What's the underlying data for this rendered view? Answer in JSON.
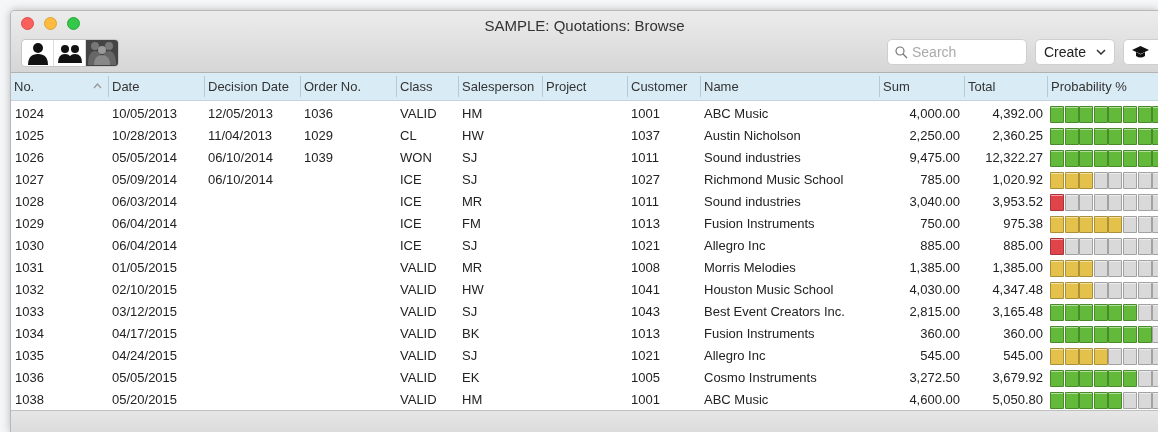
{
  "window": {
    "title": "SAMPLE: Quotations: Browse"
  },
  "toolbar": {
    "search": {
      "placeholder": "Search"
    },
    "create_button": "Create"
  },
  "table": {
    "columns": [
      {
        "label": "No.",
        "sorted": true,
        "kind": "text"
      },
      {
        "label": "Date",
        "sorted": false,
        "kind": "text"
      },
      {
        "label": "Decision Date",
        "sorted": false,
        "kind": "text"
      },
      {
        "label": "Order No.",
        "sorted": false,
        "kind": "text"
      },
      {
        "label": "Class",
        "sorted": false,
        "kind": "text"
      },
      {
        "label": "Salesperson",
        "sorted": false,
        "kind": "text"
      },
      {
        "label": "Project",
        "sorted": false,
        "kind": "text"
      },
      {
        "label": "Customer",
        "sorted": false,
        "kind": "text"
      },
      {
        "label": "Name",
        "sorted": false,
        "kind": "text"
      },
      {
        "label": "Sum",
        "sorted": false,
        "kind": "number"
      },
      {
        "label": "Total",
        "sorted": false,
        "kind": "number"
      },
      {
        "label": "Probability %",
        "sorted": false,
        "kind": "meter"
      }
    ],
    "rows": [
      {
        "cells": [
          "1024",
          "10/05/2013",
          "12/05/2013",
          "1036",
          "VALID",
          "HM",
          "",
          "1001",
          "ABC Music",
          "4,000.00",
          "4,392.00"
        ],
        "segments": [
          {
            "color": "#62b93a"
          },
          {
            "color": "#62b93a"
          },
          {
            "color": "#62b93a"
          },
          {
            "color": "#62b93a"
          },
          {
            "color": "#62b93a"
          },
          {
            "color": "#62b93a"
          },
          {
            "color": "#62b93a"
          },
          {
            "color": "#62b93a"
          }
        ]
      },
      {
        "cells": [
          "1025",
          "10/28/2013",
          "11/04/2013",
          "1029",
          "CL",
          "HW",
          "",
          "1037",
          "Austin Nicholson",
          "2,250.00",
          "2,360.25"
        ],
        "segments": [
          {
            "color": "#62b93a"
          },
          {
            "color": "#62b93a"
          },
          {
            "color": "#62b93a"
          },
          {
            "color": "#62b93a"
          },
          {
            "color": "#62b93a"
          },
          {
            "color": "#62b93a"
          },
          {
            "color": "#62b93a"
          },
          {
            "color": "#62b93a"
          }
        ]
      },
      {
        "cells": [
          "1026",
          "05/05/2014",
          "06/10/2014",
          "1039",
          "WON",
          "SJ",
          "",
          "1011",
          "Sound industries",
          "9,475.00",
          "12,322.27"
        ],
        "segments": [
          {
            "color": "#62b93a"
          },
          {
            "color": "#62b93a"
          },
          {
            "color": "#62b93a"
          },
          {
            "color": "#62b93a"
          },
          {
            "color": "#62b93a"
          },
          {
            "color": "#62b93a"
          },
          {
            "color": "#62b93a"
          },
          {
            "color": "#62b93a"
          }
        ]
      },
      {
        "cells": [
          "1027",
          "05/09/2014",
          "06/10/2014",
          "",
          "ICE",
          "SJ",
          "",
          "1027",
          "Richmond Music School",
          "785.00",
          "1,020.92"
        ],
        "segments": [
          {
            "color": "#e3c14a"
          },
          {
            "color": "#e3c14a"
          },
          {
            "color": "#e3c14a"
          },
          {
            "color": "#d9d9d9"
          },
          {
            "color": "#d9d9d9"
          },
          {
            "color": "#d9d9d9"
          },
          {
            "color": "#d9d9d9"
          },
          {
            "color": "#d9d9d9"
          }
        ]
      },
      {
        "cells": [
          "1028",
          "06/03/2014",
          "",
          "",
          "ICE",
          "MR",
          "",
          "1011",
          "Sound industries",
          "3,040.00",
          "3,953.52"
        ],
        "segments": [
          {
            "color": "#e0444b"
          },
          {
            "color": "#d9d9d9"
          },
          {
            "color": "#d9d9d9"
          },
          {
            "color": "#d9d9d9"
          },
          {
            "color": "#d9d9d9"
          },
          {
            "color": "#d9d9d9"
          },
          {
            "color": "#d9d9d9"
          },
          {
            "color": "#d9d9d9"
          }
        ]
      },
      {
        "cells": [
          "1029",
          "06/04/2014",
          "",
          "",
          "ICE",
          "FM",
          "",
          "1013",
          "Fusion Instruments",
          "750.00",
          "975.38"
        ],
        "segments": [
          {
            "color": "#e3c14a"
          },
          {
            "color": "#e3c14a"
          },
          {
            "color": "#e3c14a"
          },
          {
            "color": "#e3c14a"
          },
          {
            "color": "#e3c14a"
          },
          {
            "color": "#d9d9d9"
          },
          {
            "color": "#d9d9d9"
          },
          {
            "color": "#d9d9d9"
          }
        ]
      },
      {
        "cells": [
          "1030",
          "06/04/2014",
          "",
          "",
          "ICE",
          "SJ",
          "",
          "1021",
          "Allegro Inc",
          "885.00",
          "885.00"
        ],
        "segments": [
          {
            "color": "#e0444b"
          },
          {
            "color": "#d9d9d9"
          },
          {
            "color": "#d9d9d9"
          },
          {
            "color": "#d9d9d9"
          },
          {
            "color": "#d9d9d9"
          },
          {
            "color": "#d9d9d9"
          },
          {
            "color": "#d9d9d9"
          },
          {
            "color": "#d9d9d9"
          }
        ]
      },
      {
        "cells": [
          "1031",
          "01/05/2015",
          "",
          "",
          "VALID",
          "MR",
          "",
          "1008",
          "Morris Melodies",
          "1,385.00",
          "1,385.00"
        ],
        "segments": [
          {
            "color": "#e3c14a"
          },
          {
            "color": "#e3c14a"
          },
          {
            "color": "#e3c14a"
          },
          {
            "color": "#d9d9d9"
          },
          {
            "color": "#d9d9d9"
          },
          {
            "color": "#d9d9d9"
          },
          {
            "color": "#d9d9d9"
          },
          {
            "color": "#d9d9d9"
          }
        ]
      },
      {
        "cells": [
          "1032",
          "02/10/2015",
          "",
          "",
          "VALID",
          "HW",
          "",
          "1041",
          "Houston Music School",
          "4,030.00",
          "4,347.48"
        ],
        "segments": [
          {
            "color": "#e3c14a"
          },
          {
            "color": "#e3c14a"
          },
          {
            "color": "#e3c14a"
          },
          {
            "color": "#d9d9d9"
          },
          {
            "color": "#d9d9d9"
          },
          {
            "color": "#d9d9d9"
          },
          {
            "color": "#d9d9d9"
          },
          {
            "color": "#d9d9d9"
          }
        ]
      },
      {
        "cells": [
          "1033",
          "03/12/2015",
          "",
          "",
          "VALID",
          "SJ",
          "",
          "1043",
          "Best Event Creators Inc.",
          "2,815.00",
          "3,165.48"
        ],
        "segments": [
          {
            "color": "#62b93a"
          },
          {
            "color": "#62b93a"
          },
          {
            "color": "#62b93a"
          },
          {
            "color": "#62b93a"
          },
          {
            "color": "#62b93a"
          },
          {
            "color": "#62b93a"
          },
          {
            "color": "#d9d9d9"
          },
          {
            "color": "#d9d9d9"
          }
        ]
      },
      {
        "cells": [
          "1034",
          "04/17/2015",
          "",
          "",
          "VALID",
          "BK",
          "",
          "1013",
          "Fusion Instruments",
          "360.00",
          "360.00"
        ],
        "segments": [
          {
            "color": "#62b93a"
          },
          {
            "color": "#62b93a"
          },
          {
            "color": "#62b93a"
          },
          {
            "color": "#62b93a"
          },
          {
            "color": "#62b93a"
          },
          {
            "color": "#62b93a"
          },
          {
            "color": "#62b93a"
          },
          {
            "color": "#d9d9d9"
          }
        ]
      },
      {
        "cells": [
          "1035",
          "04/24/2015",
          "",
          "",
          "VALID",
          "SJ",
          "",
          "1021",
          "Allegro Inc",
          "545.00",
          "545.00"
        ],
        "segments": [
          {
            "color": "#e3c14a"
          },
          {
            "color": "#e3c14a"
          },
          {
            "color": "#e3c14a"
          },
          {
            "color": "#e3c14a"
          },
          {
            "color": "#d9d9d9"
          },
          {
            "color": "#d9d9d9"
          },
          {
            "color": "#d9d9d9"
          },
          {
            "color": "#d9d9d9"
          }
        ]
      },
      {
        "cells": [
          "1036",
          "05/05/2015",
          "",
          "",
          "VALID",
          "EK",
          "",
          "1005",
          "Cosmo Instruments",
          "3,272.50",
          "3,679.92"
        ],
        "segments": [
          {
            "color": "#62b93a"
          },
          {
            "color": "#62b93a"
          },
          {
            "color": "#62b93a"
          },
          {
            "color": "#62b93a"
          },
          {
            "color": "#62b93a"
          },
          {
            "color": "#62b93a"
          },
          {
            "color": "#d9d9d9"
          },
          {
            "color": "#d9d9d9"
          }
        ]
      },
      {
        "cells": [
          "1038",
          "05/20/2015",
          "",
          "",
          "VALID",
          "HM",
          "",
          "1001",
          "ABC Music",
          "4,600.00",
          "5,050.80"
        ],
        "segments": [
          {
            "color": "#62b93a"
          },
          {
            "color": "#62b93a"
          },
          {
            "color": "#62b93a"
          },
          {
            "color": "#62b93a"
          },
          {
            "color": "#62b93a"
          },
          {
            "color": "#d9d9d9"
          },
          {
            "color": "#d9d9d9"
          },
          {
            "color": "#d9d9d9"
          }
        ]
      }
    ]
  }
}
